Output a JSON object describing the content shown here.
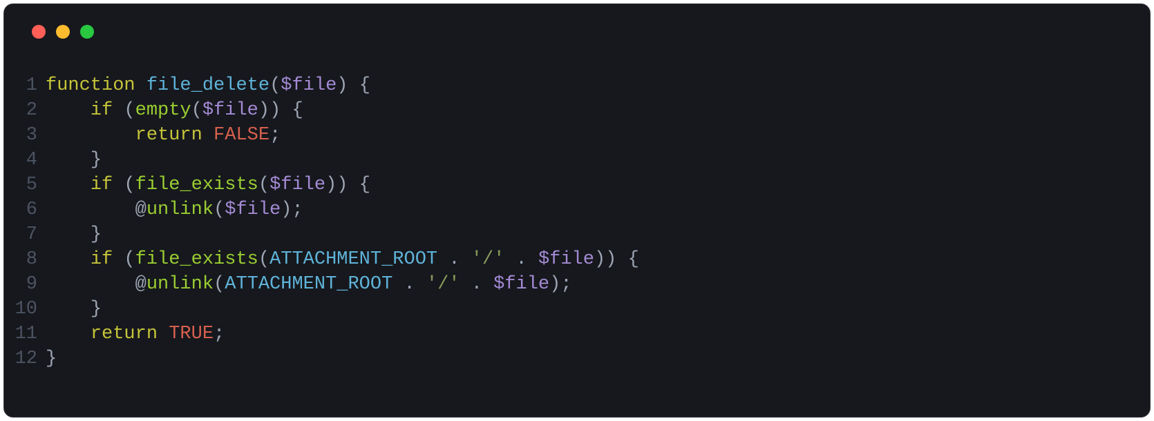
{
  "titlebar": {
    "dots": [
      "red",
      "yellow",
      "green"
    ]
  },
  "code": {
    "lines": [
      {
        "n": "1",
        "tokens": [
          {
            "t": "function",
            "c": "tok-keyword"
          },
          {
            "t": " ",
            "c": ""
          },
          {
            "t": "file_delete",
            "c": "tok-funcdef"
          },
          {
            "t": "(",
            "c": "tok-punct"
          },
          {
            "t": "$file",
            "c": "tok-variable"
          },
          {
            "t": ")",
            "c": "tok-punct"
          },
          {
            "t": " ",
            "c": ""
          },
          {
            "t": "{",
            "c": "tok-punct"
          }
        ]
      },
      {
        "n": "2",
        "tokens": [
          {
            "t": "    ",
            "c": ""
          },
          {
            "t": "if",
            "c": "tok-keyword"
          },
          {
            "t": " ",
            "c": ""
          },
          {
            "t": "(",
            "c": "tok-punct"
          },
          {
            "t": "empty",
            "c": "tok-funccall"
          },
          {
            "t": "(",
            "c": "tok-punct"
          },
          {
            "t": "$file",
            "c": "tok-variable"
          },
          {
            "t": ")",
            "c": "tok-punct"
          },
          {
            "t": ")",
            "c": "tok-punct"
          },
          {
            "t": " ",
            "c": ""
          },
          {
            "t": "{",
            "c": "tok-punct"
          }
        ]
      },
      {
        "n": "3",
        "tokens": [
          {
            "t": "        ",
            "c": ""
          },
          {
            "t": "return",
            "c": "tok-keyword"
          },
          {
            "t": " ",
            "c": ""
          },
          {
            "t": "FALSE",
            "c": "tok-constant"
          },
          {
            "t": ";",
            "c": "tok-punct"
          }
        ]
      },
      {
        "n": "4",
        "tokens": [
          {
            "t": "    ",
            "c": ""
          },
          {
            "t": "}",
            "c": "tok-punct"
          }
        ]
      },
      {
        "n": "5",
        "tokens": [
          {
            "t": "    ",
            "c": ""
          },
          {
            "t": "if",
            "c": "tok-keyword"
          },
          {
            "t": " ",
            "c": ""
          },
          {
            "t": "(",
            "c": "tok-punct"
          },
          {
            "t": "file_exists",
            "c": "tok-funccall"
          },
          {
            "t": "(",
            "c": "tok-punct"
          },
          {
            "t": "$file",
            "c": "tok-variable"
          },
          {
            "t": ")",
            "c": "tok-punct"
          },
          {
            "t": ")",
            "c": "tok-punct"
          },
          {
            "t": " ",
            "c": ""
          },
          {
            "t": "{",
            "c": "tok-punct"
          }
        ]
      },
      {
        "n": "6",
        "tokens": [
          {
            "t": "        @",
            "c": "tok-operator"
          },
          {
            "t": "unlink",
            "c": "tok-funccall"
          },
          {
            "t": "(",
            "c": "tok-punct"
          },
          {
            "t": "$file",
            "c": "tok-variable"
          },
          {
            "t": ")",
            "c": "tok-punct"
          },
          {
            "t": ";",
            "c": "tok-punct"
          }
        ]
      },
      {
        "n": "7",
        "tokens": [
          {
            "t": "    ",
            "c": ""
          },
          {
            "t": "}",
            "c": "tok-punct"
          }
        ]
      },
      {
        "n": "8",
        "tokens": [
          {
            "t": "    ",
            "c": ""
          },
          {
            "t": "if",
            "c": "tok-keyword"
          },
          {
            "t": " ",
            "c": ""
          },
          {
            "t": "(",
            "c": "tok-punct"
          },
          {
            "t": "file_exists",
            "c": "tok-funccall"
          },
          {
            "t": "(",
            "c": "tok-punct"
          },
          {
            "t": "ATTACHMENT_ROOT",
            "c": "tok-classname"
          },
          {
            "t": " ",
            "c": ""
          },
          {
            "t": ".",
            "c": "tok-operator"
          },
          {
            "t": " ",
            "c": ""
          },
          {
            "t": "'/'",
            "c": "tok-string"
          },
          {
            "t": " ",
            "c": ""
          },
          {
            "t": ".",
            "c": "tok-operator"
          },
          {
            "t": " ",
            "c": ""
          },
          {
            "t": "$file",
            "c": "tok-variable"
          },
          {
            "t": ")",
            "c": "tok-punct"
          },
          {
            "t": ")",
            "c": "tok-punct"
          },
          {
            "t": " ",
            "c": ""
          },
          {
            "t": "{",
            "c": "tok-punct"
          }
        ]
      },
      {
        "n": "9",
        "tokens": [
          {
            "t": "        @",
            "c": "tok-operator"
          },
          {
            "t": "unlink",
            "c": "tok-funccall"
          },
          {
            "t": "(",
            "c": "tok-punct"
          },
          {
            "t": "ATTACHMENT_ROOT",
            "c": "tok-classname"
          },
          {
            "t": " ",
            "c": ""
          },
          {
            "t": ".",
            "c": "tok-operator"
          },
          {
            "t": " ",
            "c": ""
          },
          {
            "t": "'/'",
            "c": "tok-string"
          },
          {
            "t": " ",
            "c": ""
          },
          {
            "t": ".",
            "c": "tok-operator"
          },
          {
            "t": " ",
            "c": ""
          },
          {
            "t": "$file",
            "c": "tok-variable"
          },
          {
            "t": ")",
            "c": "tok-punct"
          },
          {
            "t": ";",
            "c": "tok-punct"
          }
        ]
      },
      {
        "n": "10",
        "tokens": [
          {
            "t": "    ",
            "c": ""
          },
          {
            "t": "}",
            "c": "tok-punct"
          }
        ]
      },
      {
        "n": "11",
        "tokens": [
          {
            "t": "    ",
            "c": ""
          },
          {
            "t": "return",
            "c": "tok-keyword"
          },
          {
            "t": " ",
            "c": ""
          },
          {
            "t": "TRUE",
            "c": "tok-constant"
          },
          {
            "t": ";",
            "c": "tok-punct"
          }
        ]
      },
      {
        "n": "12",
        "tokens": [
          {
            "t": "}",
            "c": "tok-punct"
          }
        ]
      }
    ]
  }
}
